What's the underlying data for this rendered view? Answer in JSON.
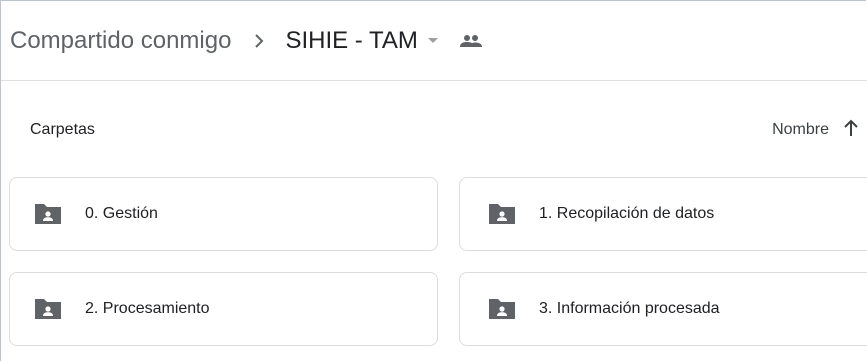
{
  "breadcrumb": {
    "root": "Compartido conmigo",
    "separator": ">",
    "current": "SIHIE - TAM"
  },
  "section": {
    "title": "Carpetas",
    "sort_label": "Nombre"
  },
  "folders": [
    {
      "name": "0. Gestión"
    },
    {
      "name": "1. Recopilación de datos"
    },
    {
      "name": "2. Procesamiento"
    },
    {
      "name": "3. Información procesada"
    }
  ],
  "colors": {
    "icon": "#5f6368",
    "border": "#dadce0",
    "text": "#202124"
  },
  "icons": {
    "shared": "people-icon",
    "folder": "shared-folder-icon",
    "sort": "arrow-up-icon",
    "dropdown": "caret-down-icon"
  }
}
